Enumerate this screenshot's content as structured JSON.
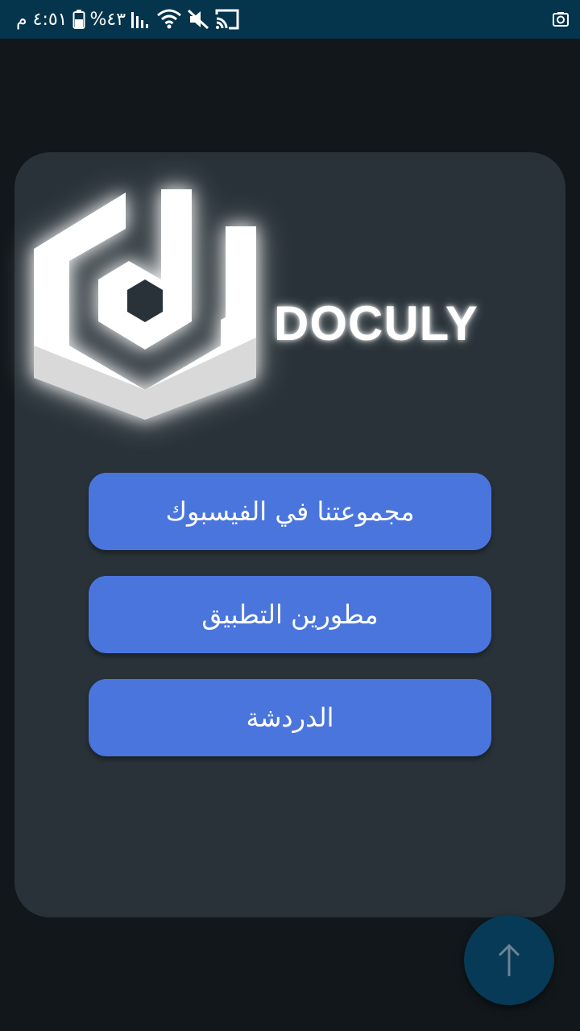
{
  "status_bar": {
    "time": "٤:٥١ م",
    "battery": "%٤٣",
    "icons": [
      "battery-icon",
      "signal-icon",
      "wifi-icon",
      "mute-icon",
      "cast-icon",
      "screenshot-icon"
    ]
  },
  "card": {
    "brand_name": "DOCULY",
    "buttons": [
      {
        "label": "مجموعتنا في الفيسبوك"
      },
      {
        "label": "مطورين التطبيق"
      },
      {
        "label": "الدردشة"
      }
    ]
  },
  "fab": {
    "icon": "arrow-up-icon"
  },
  "colors": {
    "background": "#11171b",
    "status_bar": "#05344d",
    "card": "#283238",
    "button": "#4a75dd",
    "fab": "#063a56"
  }
}
